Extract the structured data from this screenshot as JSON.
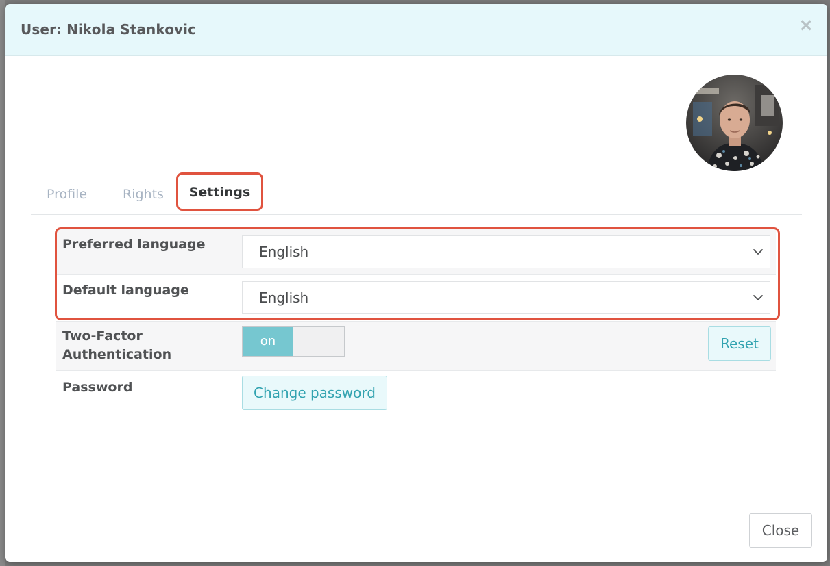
{
  "dialog": {
    "title": "User: Nikola Stankovic",
    "close_glyph": "×"
  },
  "tabs": [
    {
      "label": "Profile",
      "active": false
    },
    {
      "label": "Rights",
      "active": false
    },
    {
      "label": "Settings",
      "active": true
    }
  ],
  "settings": {
    "preferred_language": {
      "label": "Preferred language",
      "value": "English"
    },
    "default_language": {
      "label": "Default language",
      "value": "English"
    },
    "two_factor": {
      "label_line1": "Two-Factor",
      "label_line2": "Authentication",
      "toggle_text": "on",
      "reset_label": "Reset"
    },
    "password": {
      "label": "Password",
      "button_label": "Change password"
    }
  },
  "footer": {
    "close_label": "Close"
  },
  "colors": {
    "header_bg": "#e6f8fb",
    "accent": "#32a3b0",
    "toggle_on": "#76c7d0",
    "highlight": "#e0533f"
  },
  "icons": {
    "dialog_close": "close-icon",
    "select_caret": "chevron-down-icon",
    "avatar": "user-avatar"
  }
}
